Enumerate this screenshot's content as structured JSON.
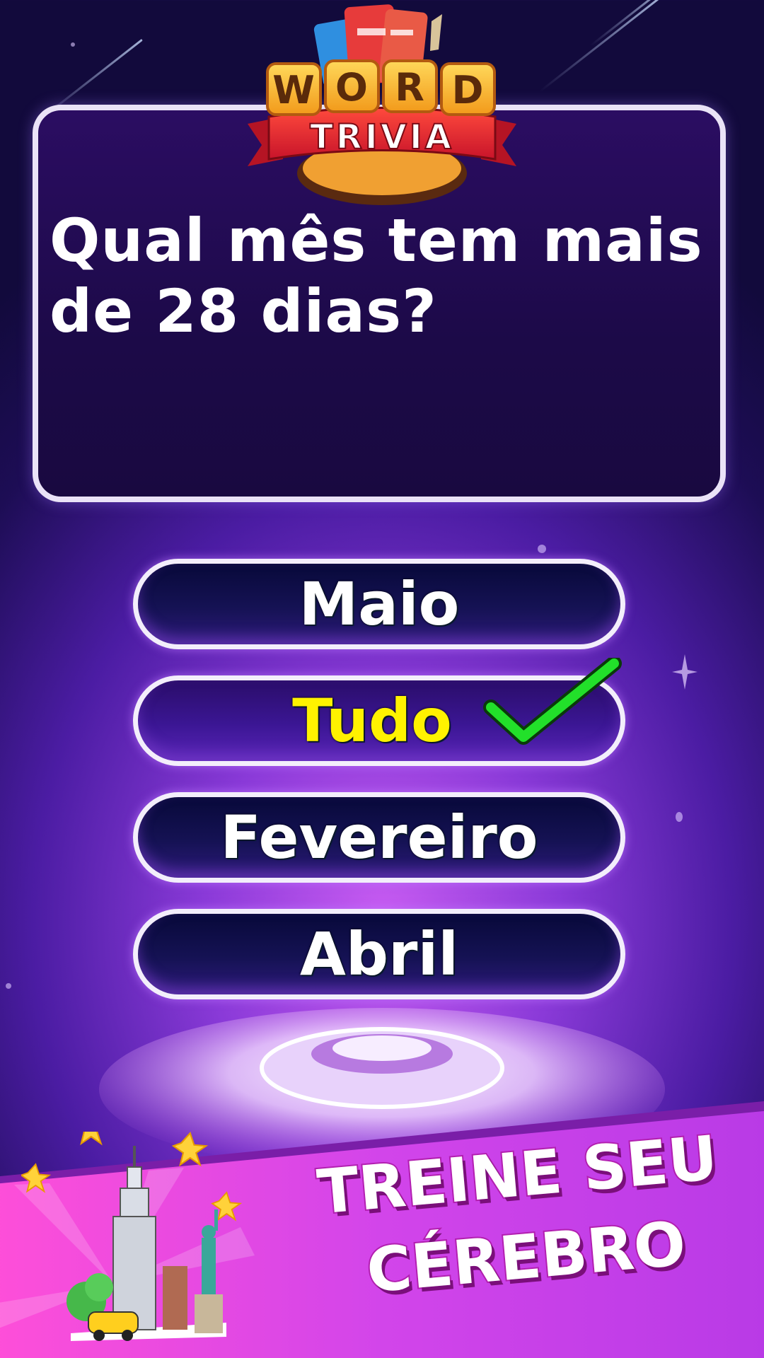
{
  "logo": {
    "word_letters": [
      "W",
      "O",
      "R",
      "D"
    ],
    "subtitle": "TRIVIA"
  },
  "question": {
    "line1": "Qual mês tem mais",
    "line2": "de 28 dias?"
  },
  "answers": [
    {
      "label": "Maio",
      "correct": false
    },
    {
      "label": "Tudo",
      "correct": true
    },
    {
      "label": "Fevereiro",
      "correct": false
    },
    {
      "label": "Abril",
      "correct": false
    }
  ],
  "banner": {
    "line1": "TREINE SEU",
    "line2": "CÉREBRO"
  },
  "colors": {
    "correct_text": "#fff200",
    "check_mark": "#22e02a",
    "banner_bg": "#d84ee8"
  }
}
